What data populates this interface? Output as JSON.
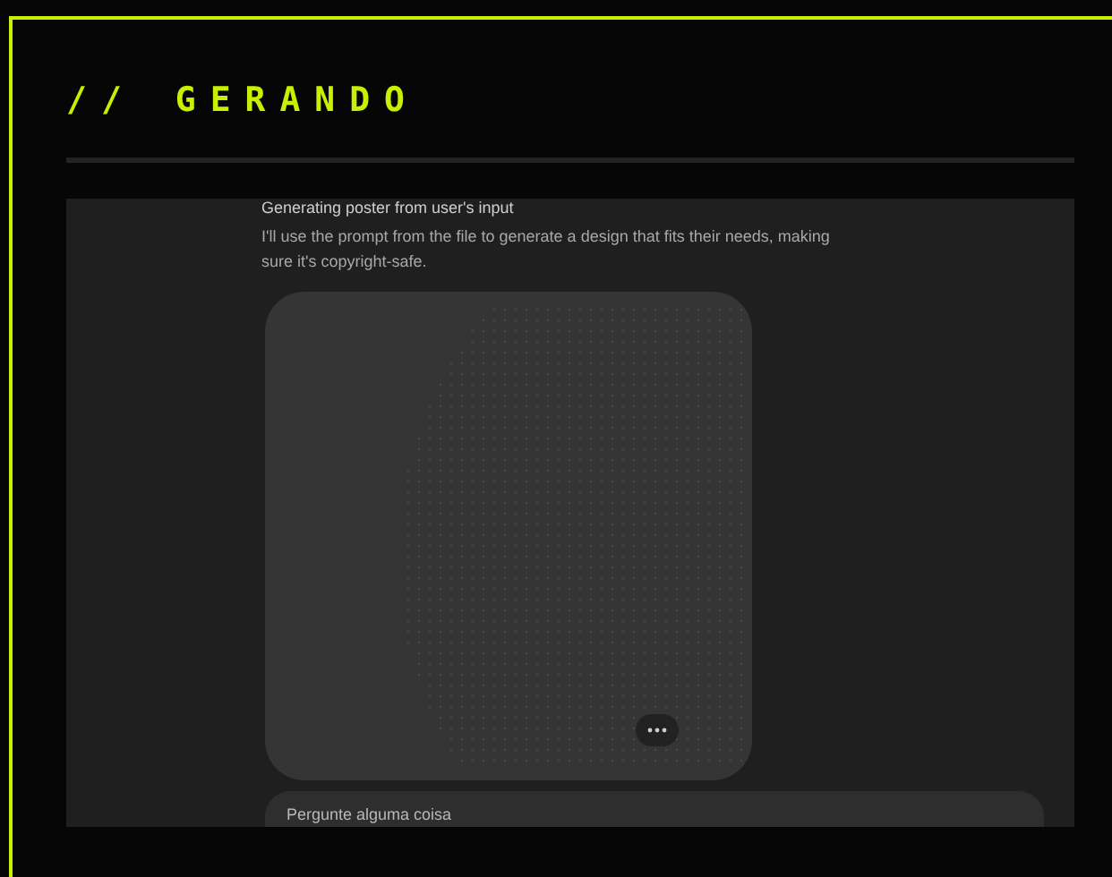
{
  "heading": {
    "prefix": "//",
    "title": "GERANDO"
  },
  "chat": {
    "status": "Generating poster from user's input",
    "message": "I'll use the prompt from the file to generate a design that fits their needs, making sure it's copyright-safe.",
    "composer": {
      "placeholder": "Pergunte alguma coisa"
    }
  }
}
